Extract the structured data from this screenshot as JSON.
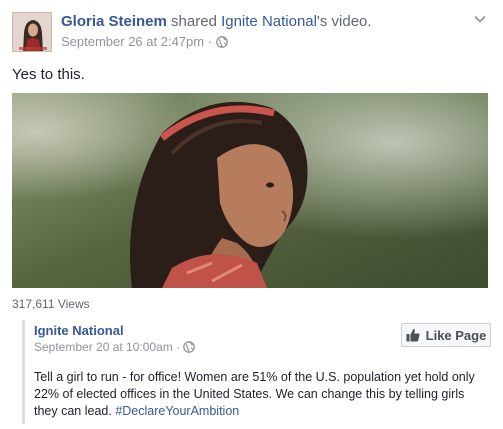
{
  "post": {
    "author": "Gloria Steinem",
    "action": " shared ",
    "page": "Ignite National",
    "possessive_suffix": "'s video.",
    "timestamp": "September 26 at 2:47pm",
    "separator": " · ",
    "text": "Yes to this.",
    "views": "317,611 Views"
  },
  "shared": {
    "page": "Ignite National",
    "timestamp": "September 20 at 10:00am",
    "separator": " · ",
    "like_label": "Like Page",
    "text": "Tell a girl to run - for office! Women are 51% of the U.S. population yet hold only 22% of elected offices in the United States. We can change this by telling girls they can lead. ",
    "hashtag": "#DeclareYourAmbition"
  },
  "colors": {
    "link": "#365899",
    "meta": "#90949c",
    "border": "#dcdee3"
  },
  "icons": [
    "globe-icon",
    "chevron-down-icon",
    "thumbs-up-icon"
  ]
}
